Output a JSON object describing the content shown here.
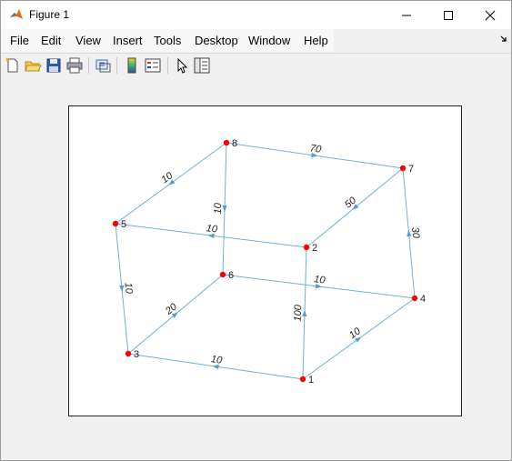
{
  "window": {
    "title": "Figure 1"
  },
  "menu": [
    "File",
    "Edit",
    "View",
    "Insert",
    "Tools",
    "Desktop",
    "Window",
    "Help"
  ],
  "toolbar": [
    "new-figure-icon",
    "open-file-icon",
    "save-icon",
    "print-icon",
    "link-icon",
    "colorbar-icon",
    "legend-icon",
    "pointer-icon",
    "property-inspector-icon"
  ],
  "chart_data": {
    "type": "graph",
    "nodes": [
      {
        "id": "1"
      },
      {
        "id": "2"
      },
      {
        "id": "3"
      },
      {
        "id": "4"
      },
      {
        "id": "5"
      },
      {
        "id": "6"
      },
      {
        "id": "7"
      },
      {
        "id": "8"
      }
    ],
    "edges": [
      {
        "from": "8",
        "to": "7",
        "weight": "70"
      },
      {
        "from": "8",
        "to": "5",
        "weight": "10"
      },
      {
        "from": "8",
        "to": "6",
        "weight": "10"
      },
      {
        "from": "7",
        "to": "2",
        "weight": "50"
      },
      {
        "from": "2",
        "to": "5",
        "weight": "10"
      },
      {
        "from": "5",
        "to": "3",
        "weight": "10"
      },
      {
        "from": "6",
        "to": "4",
        "weight": "10"
      },
      {
        "from": "4",
        "to": "7",
        "weight": "30"
      },
      {
        "from": "3",
        "to": "6",
        "weight": "20"
      },
      {
        "from": "1",
        "to": "2",
        "weight": "100"
      },
      {
        "from": "1",
        "to": "3",
        "weight": "10"
      },
      {
        "from": "1",
        "to": "4",
        "weight": "10"
      }
    ],
    "colors": {
      "node": "#ff0000",
      "edge": "#6fb0d8",
      "arrow": "#4f9fd2"
    }
  }
}
